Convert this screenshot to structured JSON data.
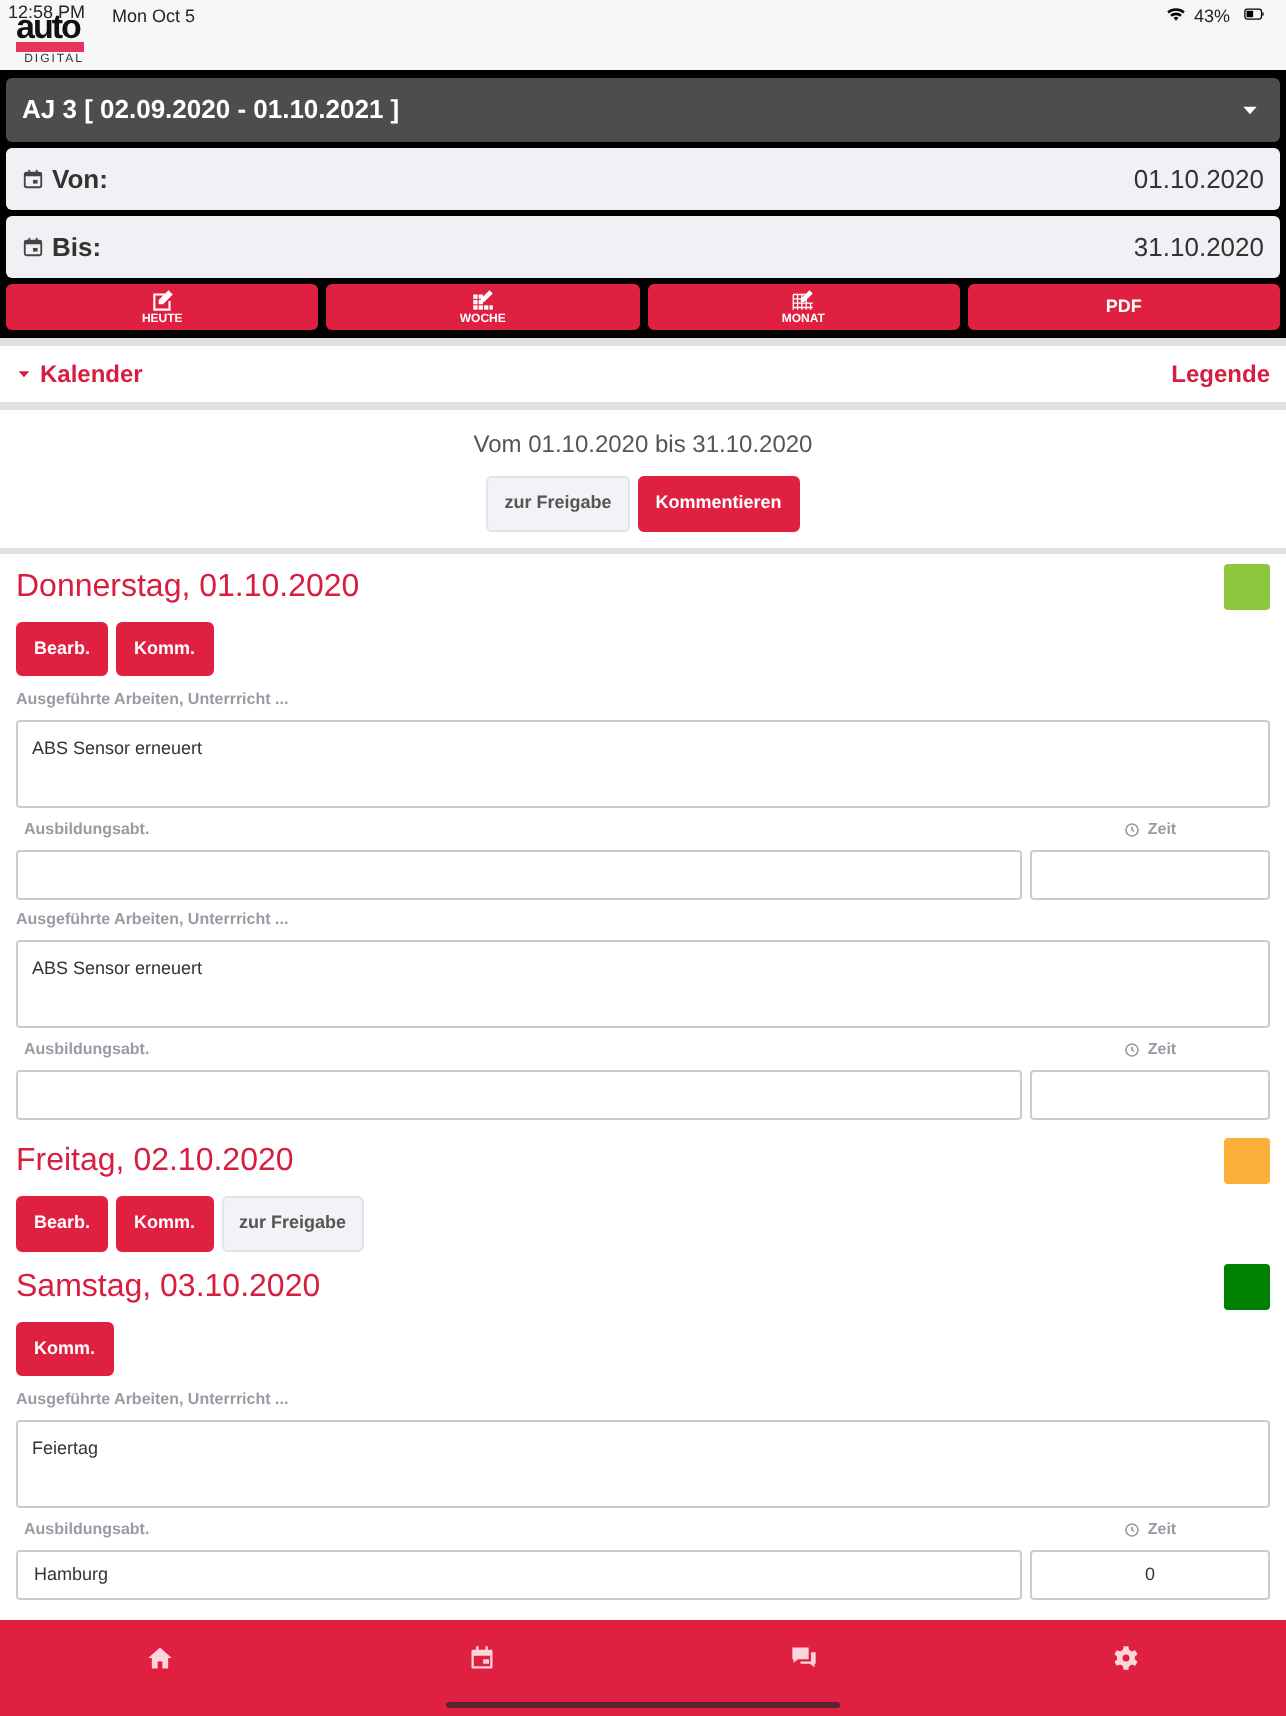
{
  "status_bar": {
    "time": "12:58 PM",
    "date": "Mon Oct 5",
    "battery": "43%"
  },
  "logo": {
    "word": "auto",
    "sub": "DIGITAL"
  },
  "period_select": {
    "value": "AJ 3 [ 02.09.2020 - 01.10.2021 ]"
  },
  "date_fields": [
    {
      "label": "Von:",
      "value": "01.10.2020"
    },
    {
      "label": "Bis:",
      "value": "31.10.2020"
    }
  ],
  "toolbar": [
    {
      "kind": "today",
      "label": "HEUTE"
    },
    {
      "kind": "week",
      "label": "WOCHE"
    },
    {
      "kind": "month",
      "label": "MONAT"
    },
    {
      "kind": "text",
      "label": "PDF"
    }
  ],
  "calendar_bar": {
    "toggle": "Kalender",
    "expanded": false,
    "legend": "Legende"
  },
  "range": {
    "text": "Vom 01.10.2020 bis 31.10.2020",
    "buttons": [
      {
        "label": "zur Freigabe",
        "kind": "light"
      },
      {
        "label": "Kommentieren",
        "kind": "primary"
      }
    ]
  },
  "days": [
    {
      "title": "Donnerstag, 01.10.2020",
      "color": "#8dc63f",
      "buttons": [
        {
          "label": "Bearb.",
          "kind": "primary"
        },
        {
          "label": "Komm.",
          "kind": "primary"
        }
      ],
      "entries": [
        {
          "work_label": "Ausgeführte Arbeiten, Unterrricht ...",
          "work": "ABS Sensor erneuert",
          "dept_label": "Ausbildungsabt.",
          "time_label": "Zeit"
        },
        {
          "work_label": "Ausgeführte Arbeiten, Unterrricht ...",
          "work": "ABS Sensor erneuert",
          "dept_label": "Ausbildungsabt.",
          "time_label": "Zeit"
        }
      ]
    },
    {
      "title": "Freitag, 02.10.2020",
      "color": "#fbb03b",
      "buttons": [
        {
          "label": "Bearb.",
          "kind": "primary"
        },
        {
          "label": "Komm.",
          "kind": "primary"
        },
        {
          "label": "zur Freigabe",
          "kind": "light"
        }
      ]
    },
    {
      "title": "Samstag, 03.10.2020",
      "color": "#008000",
      "buttons": [
        {
          "label": "Komm.",
          "kind": "primary"
        }
      ],
      "entries": [
        {
          "work_label": "Ausgeführte Arbeiten, Unterrricht ...",
          "work": "Feiertag",
          "dept_label": "Ausbildungsabt.",
          "dept": "Hamburg",
          "time_label": "Zeit",
          "time": "0"
        }
      ]
    }
  ],
  "tab_bar": [
    {
      "kind": "home"
    },
    {
      "kind": "calendar"
    },
    {
      "kind": "chat"
    },
    {
      "kind": "settings"
    }
  ]
}
